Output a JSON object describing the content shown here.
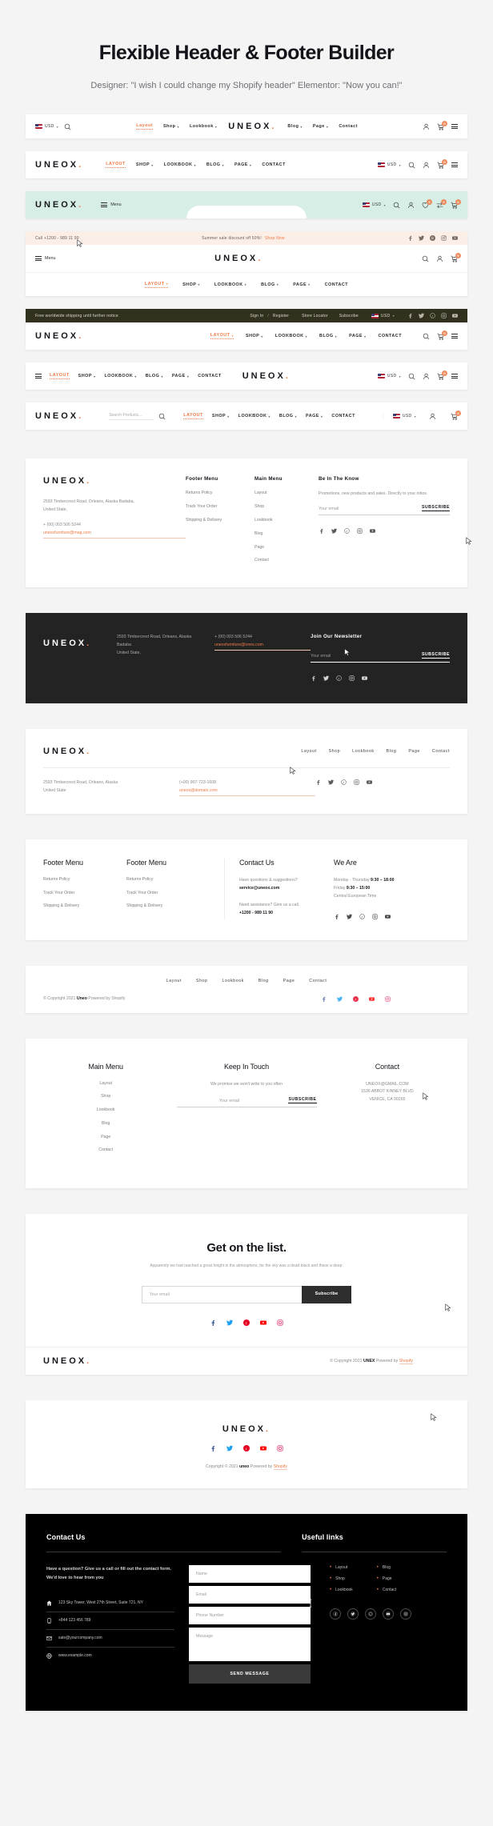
{
  "hero": {
    "title": "Flexible Header & Footer Builder",
    "subtitle": "Designer: \"I wish I could change my Shopify header\" Elementor: \"Now you can!\""
  },
  "brand": {
    "name": "UNEOX",
    "dot": ".",
    "accent": "#ee7a45"
  },
  "nav": {
    "layout": "LAYOUT",
    "shop": "SHOP",
    "lookbook": "LOOKBOOK",
    "blog": "BLOG",
    "page": "PAGE",
    "contact": "CONTACT",
    "layout_tc": "Layout",
    "shop_tc": "Shop",
    "lookbook_tc": "Lookbook",
    "blog_tc": "Blog",
    "page_tc": "Page",
    "contact_tc": "Contact"
  },
  "common": {
    "currency": "USD",
    "cart_count": "0",
    "wishlist_count": "0",
    "compare_count": "0",
    "menu_label": "Menu",
    "search_placeholder": "Search Products...",
    "subscribe": "SUBSCRIBE",
    "your_email": "Your email"
  },
  "headers": [
    {
      "id": "header-1",
      "variant": "logo-center-currency-left"
    },
    {
      "id": "header-2",
      "variant": "logo-left-nav-center"
    },
    {
      "id": "header-3",
      "variant": "mint-menu-arch"
    },
    {
      "id": "header-4",
      "variant": "announcement-peach"
    },
    {
      "id": "header-5",
      "variant": "announcement-olive"
    },
    {
      "id": "header-6",
      "variant": "hamburger-nav-left-logo-center"
    },
    {
      "id": "header-7",
      "variant": "search-left"
    }
  ],
  "announcement_peach": {
    "phone": "Call +1200 - 989 11 90",
    "message": "Summer sale discount off 50%!",
    "link": "Shop Now"
  },
  "announcement_olive": {
    "message": "Free worldwide shipping until further notice",
    "signin": "Sign In",
    "separator": "/",
    "register": "Register",
    "store_locator": "Store Locator",
    "subscribe": "Subscribe",
    "currency": "USD"
  },
  "footer1": {
    "address": "2593 Timbercrest Road, Orleans, Alaska Badaba,",
    "address2": "United State,",
    "phone": "+ (00) 003 506 5244",
    "email": "uneoxfurniture@mag.com",
    "col_footer_menu": "Footer Menu",
    "col_main_menu": "Main Menu",
    "col_know": "Be In The Know",
    "footer_links": [
      "Returns Policy",
      "Track Your Order",
      "Shipping & Delivery"
    ],
    "main_links": [
      "Layout",
      "Shop",
      "Lookbook",
      "Blog",
      "Page",
      "Contact"
    ],
    "know_text": "Promotions, new products and sales. Directly to your inbox."
  },
  "footer2": {
    "address": "2593 Timbercrest Road, Orleans, Alaska",
    "address2": "Badaba",
    "address3": "United State,",
    "phone": "+ (00) 003 506 5244",
    "email": "uneoxfurniture@ones.com",
    "newsletter_title": "Join Our Newsletter"
  },
  "footer3": {
    "address": "2593 Timbercrest Road, Orleans, Alaska",
    "address2": "United State",
    "phone": "(+00) 907-723-1608",
    "email": "uneox@domain.com"
  },
  "footer4": {
    "col1_title": "Footer Menu",
    "col2_title": "Footer Menu",
    "col1_links": [
      "Returns Policy",
      "Track Your Order",
      "Shipping & Delivery"
    ],
    "col2_links": [
      "Returns Policy",
      "Track Your Order",
      "Shipping & Delivery"
    ],
    "contact_title": "Contact Us",
    "contact_q": "Have questions & suggestions?",
    "contact_email": "service@uneox.com",
    "contact_need": "Need assistance? Give us a call.",
    "contact_phone": "+1200 - 989 11 90",
    "we_are_title": "We Are",
    "hours1_label": "Monday - Thursday ",
    "hours1": "9:30 – 18:00",
    "hours2_label": "Friday ",
    "hours2": "9:30 – 15:00",
    "timezone": "Central European Time"
  },
  "footer5": {
    "copyright_pre": "© Copyright 2021 ",
    "brand": "Uneo",
    "copyright_post": " Powered by Shopify"
  },
  "footer6": {
    "main_menu_title": "Main Menu",
    "main_links": [
      "Layout",
      "Shop",
      "Lookbook",
      "Blog",
      "Page",
      "Contact"
    ],
    "keep_title": "Keep In Touch",
    "keep_text": "We promise we won't write to you often",
    "contact_title": "Contact",
    "contact_email": "UNEOX@GMAIL.COM",
    "contact_addr": "1536 ABBOT KINNEY BLVD",
    "contact_addr2": "VENICE, CA 90265"
  },
  "footer7": {
    "title": "Get on the list.",
    "text": "Apparently we had reached a great height in the atmosphere, for the sky was a dead black and these a deep.",
    "email_placeholder": "Your email",
    "button": "Subscribe",
    "copyright_pre": "© Copyright 2021 ",
    "brand": "UNEX",
    "copyright_mid": " Powered by ",
    "shopify": "Shopify"
  },
  "footer8": {
    "copyright_pre": "Copyright © 2021 ",
    "brand": "uneo",
    "copyright_mid": " Powered by ",
    "shopify": "Shopify"
  },
  "footer9": {
    "contact_title": "Contact Us",
    "intro": "Have a question? Give us a call or fill out the contact form. We'd love to hear from you",
    "address": "123 Sky Tower, West 27th Street, Suite 721, NY",
    "phone": "+844 123 456 789",
    "email": "sale@yourcompany.com",
    "website": "www.example.com",
    "fields": {
      "name": "Name",
      "email": "Email",
      "phone": "Phone Number",
      "message": "Message"
    },
    "send": "SEND MESSAGE",
    "useful_title": "Useful links",
    "links_col1": [
      "Layout",
      "Shop",
      "Lookbook"
    ],
    "links_col2": [
      "Blog",
      "Page",
      "Contact"
    ]
  },
  "icons": {
    "search": "search-icon",
    "user": "user-icon",
    "cart": "cart-icon",
    "menu": "hamburger-icon",
    "heart": "wishlist-icon",
    "compare": "compare-icon"
  }
}
